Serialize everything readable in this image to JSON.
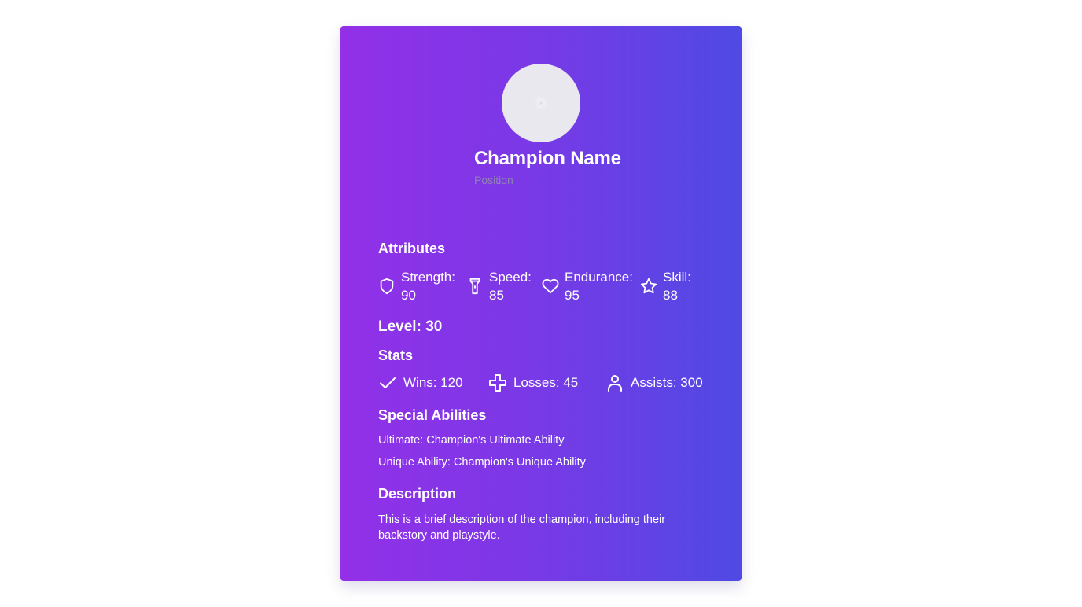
{
  "card": {
    "name": "Champion Name",
    "position": "Position"
  },
  "attributes": {
    "title": "Attributes",
    "items": [
      {
        "label": "Strength: 90",
        "icon": "shield-icon"
      },
      {
        "label": "Speed: 85",
        "icon": "flashlight-icon"
      },
      {
        "label": "Endurance: 95",
        "icon": "heart-icon"
      },
      {
        "label": "Skill: 88",
        "icon": "star-icon"
      }
    ]
  },
  "level": "Level: 30",
  "stats": {
    "title": "Stats",
    "items": [
      {
        "label": "Wins: 120",
        "icon": "check-icon"
      },
      {
        "label": "Losses: 45",
        "icon": "plus-icon"
      },
      {
        "label": "Assists: 300",
        "icon": "user-icon"
      }
    ]
  },
  "abilities": {
    "title": "Special Abilities",
    "ultimate": "Ultimate: Champion's Ultimate Ability",
    "unique": "Unique Ability: Champion's Unique Ability"
  },
  "description": {
    "title": "Description",
    "text": "This is a brief description of the champion, including their backstory and playstyle."
  }
}
